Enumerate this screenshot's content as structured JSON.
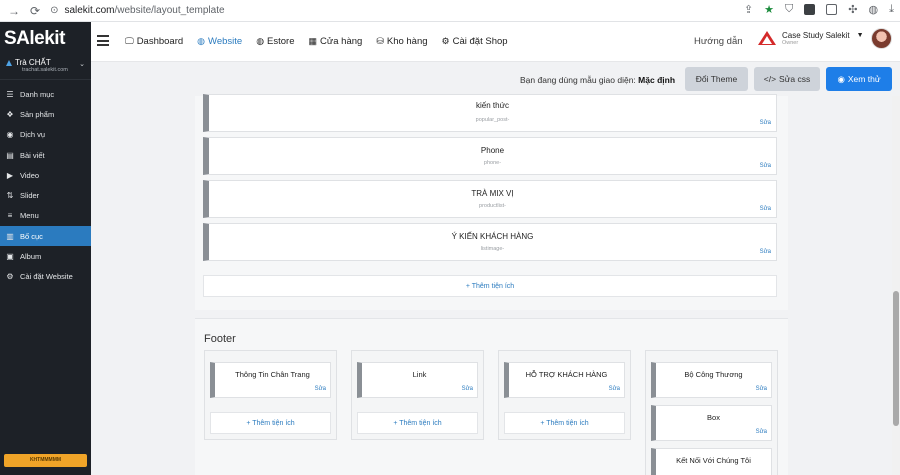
{
  "browser": {
    "url_host": "salekit.com",
    "url_path": "/website/layout_template"
  },
  "app": {
    "logo": "SAlekit"
  },
  "sidebar": {
    "shop_name": "Trà CHẤT",
    "shop_domain": "trachat.salekit.com",
    "items": [
      {
        "label": "Danh mục",
        "icon": "list-icon"
      },
      {
        "label": "Sản phẩm",
        "icon": "product-icon"
      },
      {
        "label": "Dịch vụ",
        "icon": "service-icon"
      },
      {
        "label": "Bài viết",
        "icon": "article-icon"
      },
      {
        "label": "Video",
        "icon": "video-icon"
      },
      {
        "label": "Slider",
        "icon": "slider-icon"
      },
      {
        "label": "Menu",
        "icon": "menu-icon"
      },
      {
        "label": "Bố cục",
        "icon": "layout-icon",
        "active": true
      },
      {
        "label": "Album",
        "icon": "album-icon"
      },
      {
        "label": "Cài đặt Website",
        "icon": "gear-icon"
      }
    ],
    "bottom_button": "KHTMMMMM"
  },
  "topbar": {
    "nav": [
      {
        "label": "Dashboard",
        "icon": "monitor-icon"
      },
      {
        "label": "Website",
        "icon": "globe-icon",
        "active": true
      },
      {
        "label": "Estore",
        "icon": "globe-icon"
      },
      {
        "label": "Cửa hàng",
        "icon": "store-icon"
      },
      {
        "label": "Kho hàng",
        "icon": "database-icon"
      },
      {
        "label": "Cài đặt Shop",
        "icon": "gear-icon"
      }
    ],
    "help": "Hướng dẫn",
    "account_name": "Case Study Salekit",
    "account_role": "Owner"
  },
  "actions": {
    "theme_text": "Bạn đang dùng mẫu giao diện:",
    "theme_name": "Mặc định",
    "change_theme": "Đổi Theme",
    "edit_css": "Sửa css",
    "preview": "Xem thử"
  },
  "layout": {
    "widgets": [
      {
        "title": "kiến thức",
        "sub": "popular_post-"
      },
      {
        "title": "Phone",
        "sub": "phone-"
      },
      {
        "title": "TRÀ MIX VỊ",
        "sub": "productlist-"
      },
      {
        "title": "Ý KIẾN KHÁCH HÀNG",
        "sub": "listimage-"
      }
    ],
    "edit_label": "Sửa",
    "add_label": "Thêm tiện ích"
  },
  "footer": {
    "title": "Footer",
    "columns": [
      {
        "widgets": [
          "Thông Tin Chân Trang"
        ]
      },
      {
        "widgets": [
          "Link"
        ]
      },
      {
        "widgets": [
          "HỖ TRỢ KHÁCH HÀNG"
        ]
      },
      {
        "widgets": [
          "Bộ Công Thương",
          "Box",
          "Kết Nối Với Chúng Tôi"
        ]
      }
    ]
  }
}
